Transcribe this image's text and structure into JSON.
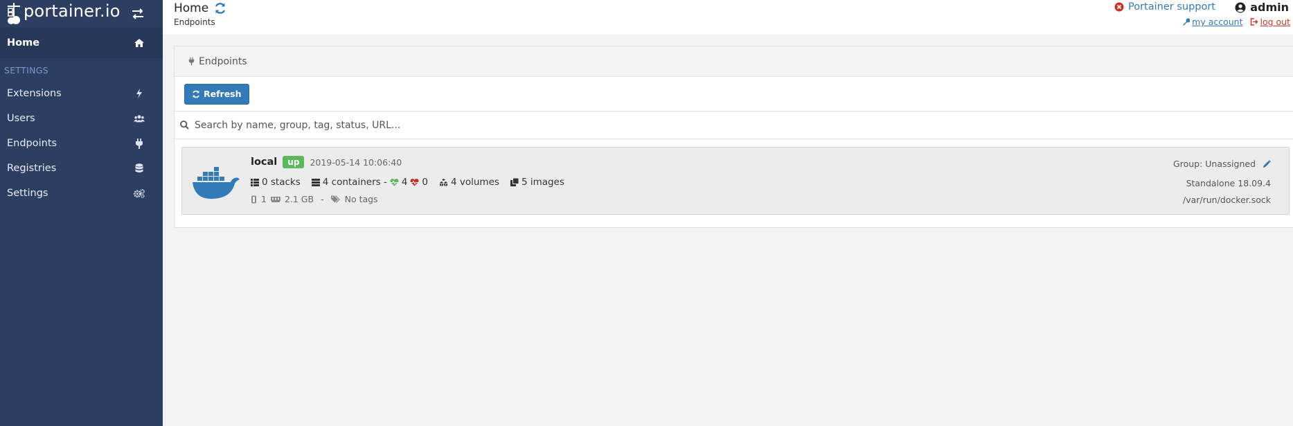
{
  "brand": {
    "name": "portainer.io"
  },
  "sidebar": {
    "home_label": "Home",
    "section_label": "SETTINGS",
    "items": [
      {
        "label": "Extensions",
        "icon": "bolt-icon"
      },
      {
        "label": "Users",
        "icon": "users-icon"
      },
      {
        "label": "Endpoints",
        "icon": "plug-icon"
      },
      {
        "label": "Registries",
        "icon": "database-icon"
      },
      {
        "label": "Settings",
        "icon": "cogs-icon"
      }
    ]
  },
  "header": {
    "title": "Home",
    "breadcrumb": "Endpoints",
    "support_label": "Portainer support",
    "username": "admin",
    "my_account_label": "my account",
    "logout_label": "log out"
  },
  "widget": {
    "title": "Endpoints",
    "refresh_label": "Refresh",
    "search_placeholder": "Search by name, group, tag, status, URL..."
  },
  "endpoint": {
    "name": "local",
    "status": "up",
    "timestamp": "2019-05-14 10:06:40",
    "stacks": "0 stacks",
    "containers": "4 containers -",
    "healthy": "4",
    "unhealthy": "0",
    "volumes": "4 volumes",
    "images": "5 images",
    "cpu": "1",
    "memory": "2.1 GB",
    "separator": "-",
    "tags": "No tags",
    "group": "Group: Unassigned",
    "engine": "Standalone 18.09.4",
    "socket": "/var/run/docker.sock"
  },
  "colors": {
    "sidebar_bg": "#2d3e63",
    "primary": "#337ab7",
    "success": "#5cb85c",
    "danger": "#c0392b"
  }
}
